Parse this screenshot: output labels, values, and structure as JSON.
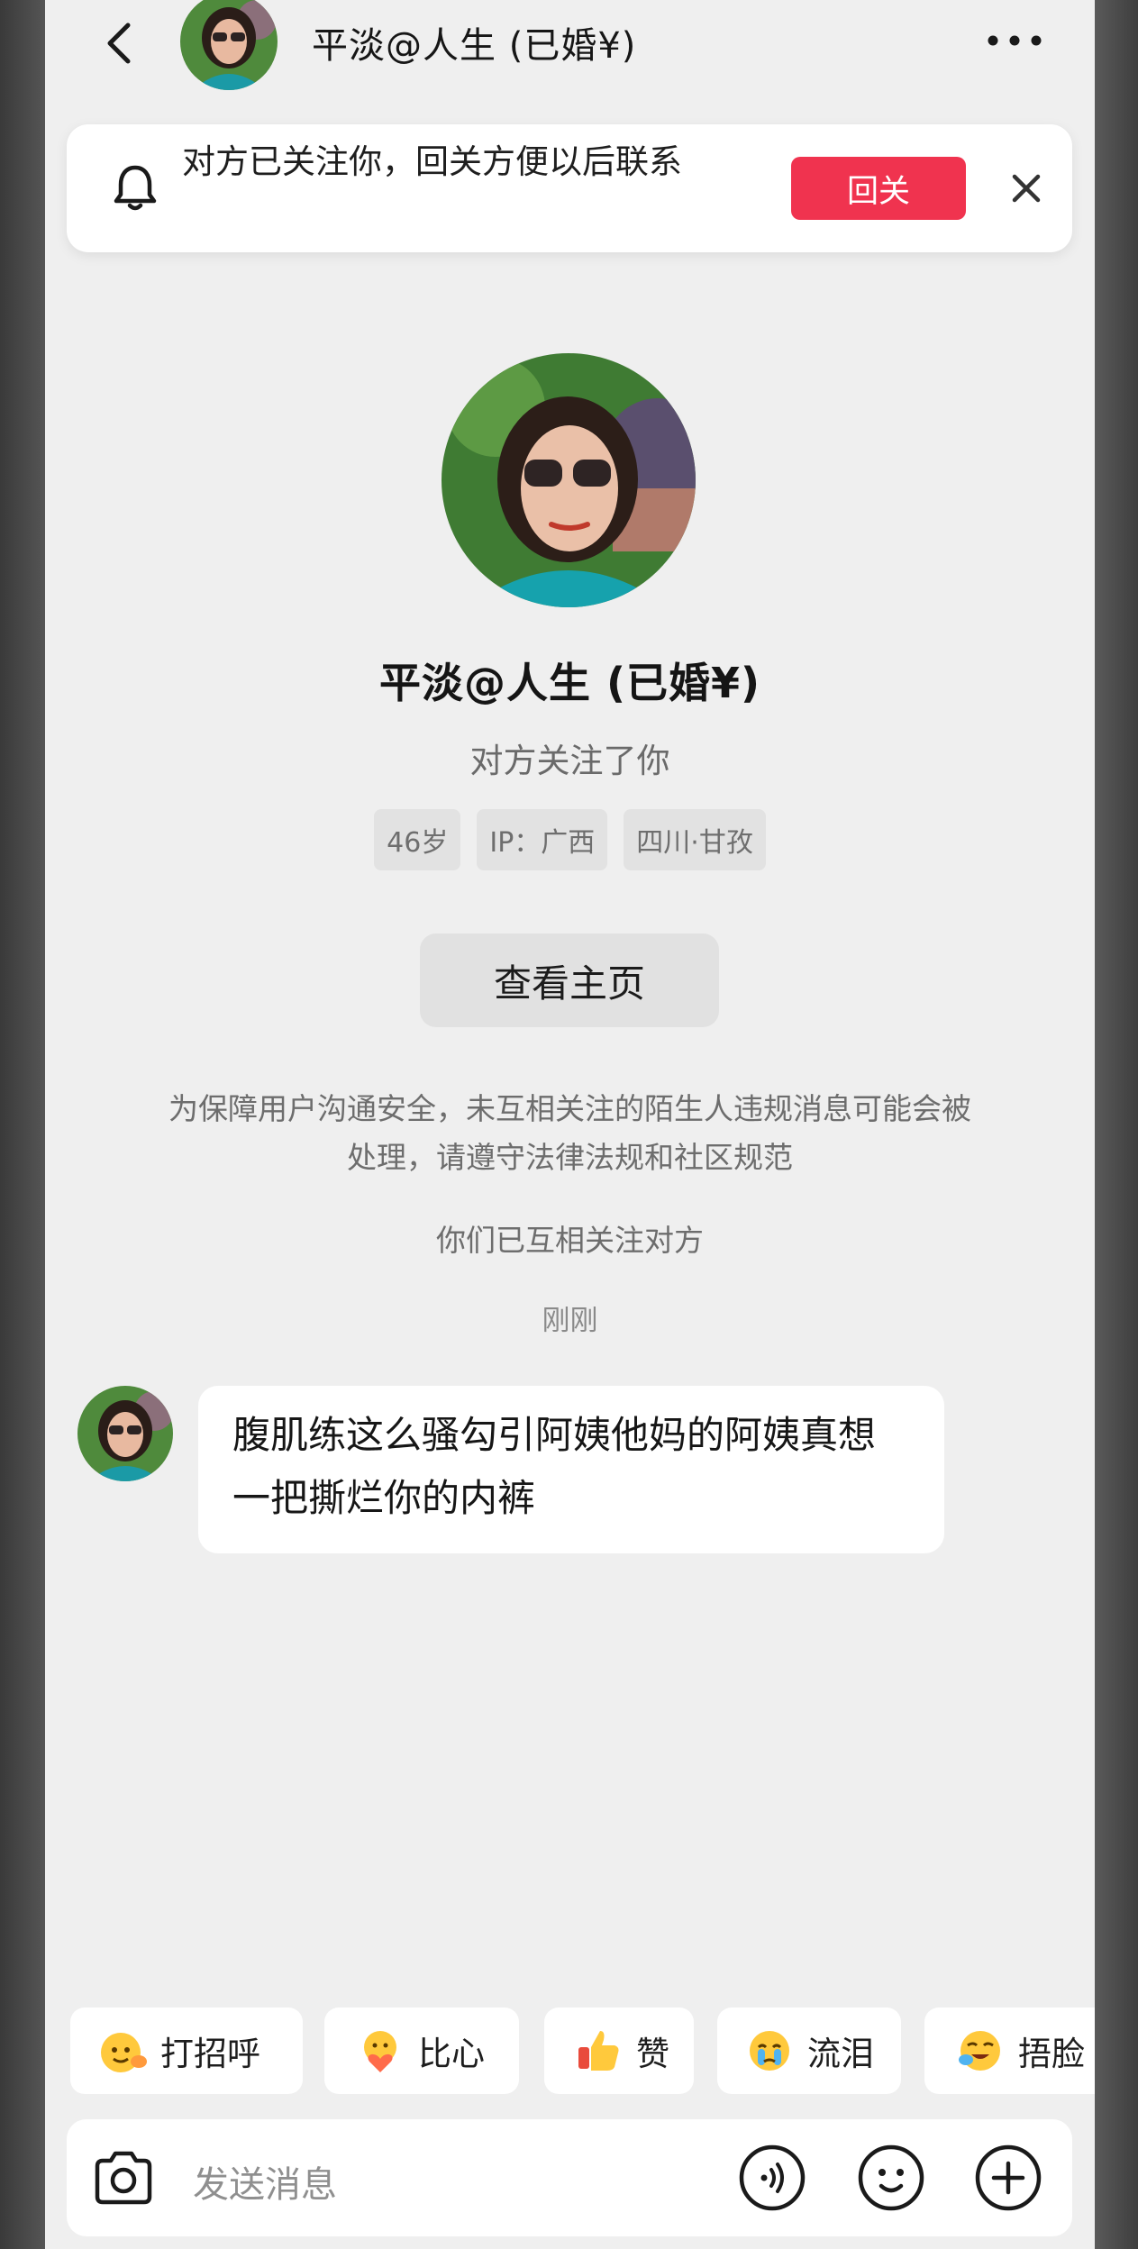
{
  "header": {
    "title": "平淡@人生 (已婚¥)"
  },
  "banner": {
    "text": "对方已关注你，回关方便以后联系",
    "button_label": "回关"
  },
  "profile": {
    "name": "平淡@人生 (已婚¥)",
    "subtitle": "对方关注了你",
    "tags": [
      "46岁",
      "IP：广西",
      "四川·甘孜"
    ],
    "view_home_label": "查看主页"
  },
  "notices": {
    "safety": "为保障用户沟通安全，未互相关注的陌生人违规消息可能会被处理，请遵守法律法规和社区规范",
    "mutual": "你们已互相关注对方",
    "time": "刚刚"
  },
  "messages": [
    {
      "text": "腹肌练这么骚勾引阿姨他妈的阿姨真想一把撕烂你的内裤"
    }
  ],
  "quick_replies": [
    {
      "label": "打招呼",
      "icon": "wave-emoji-icon"
    },
    {
      "label": "比心",
      "icon": "heart-hands-emoji-icon"
    },
    {
      "label": "赞",
      "icon": "thumbs-up-emoji-icon"
    },
    {
      "label": "流泪",
      "icon": "crying-emoji-icon"
    },
    {
      "label": "捂脸",
      "icon": "facepalm-emoji-icon"
    }
  ],
  "input": {
    "placeholder": "发送消息"
  },
  "colors": {
    "accent": "#f0334f",
    "background": "#efefef",
    "card": "#ffffff"
  }
}
